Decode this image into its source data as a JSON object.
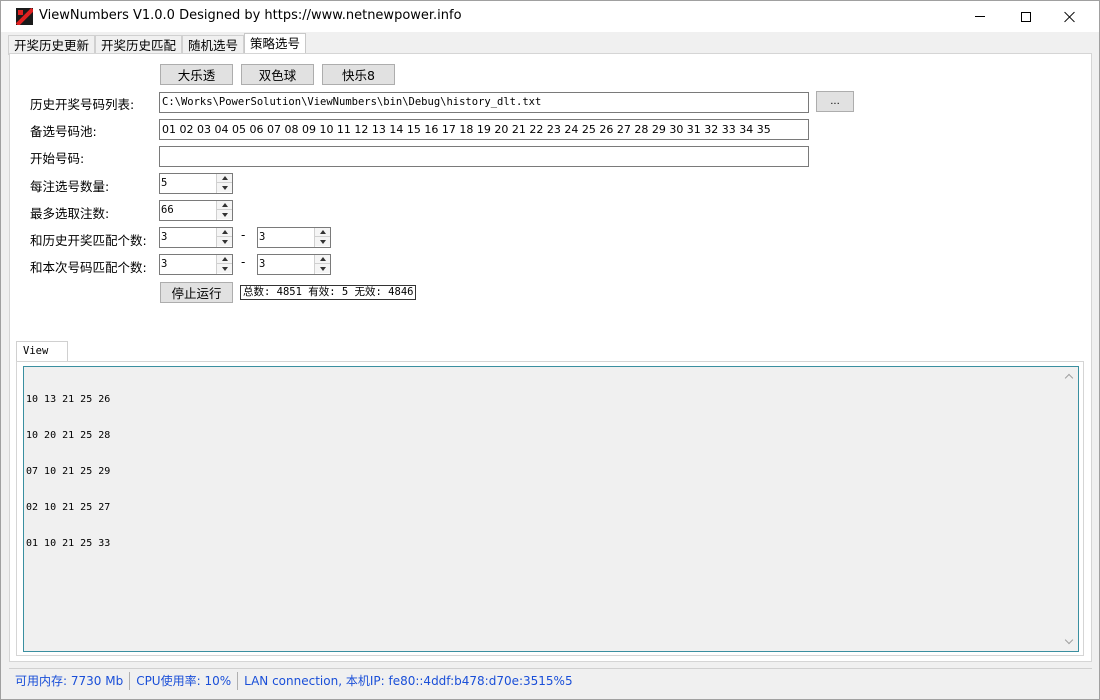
{
  "window": {
    "title": "ViewNumbers V1.0.0 Designed by https://www.netnewpower.info"
  },
  "main_tabs": [
    {
      "label": "开奖历史更新",
      "active": false
    },
    {
      "label": "开奖历史匹配",
      "active": false
    },
    {
      "label": "随机选号",
      "active": false
    },
    {
      "label": "策略选号",
      "active": true
    }
  ],
  "lottery_buttons": {
    "daletou": "大乐透",
    "shuangseqiu": "双色球",
    "kuaile8": "快乐8"
  },
  "form": {
    "history_file": {
      "label": "历史开奖号码列表:",
      "value": "C:\\Works\\PowerSolution\\ViewNumbers\\bin\\Debug\\history_dlt.txt",
      "browse_label": "..."
    },
    "candidate_pool": {
      "label": "备选号码池:",
      "value": "01 02 03 04 05 06 07 08 09 10 11 12 13 14 15 16 17 18 19 20 21 22 23 24 25 26 27 28 29 30 31 32 33 34 35"
    },
    "start_numbers": {
      "label": "开始号码:",
      "value": ""
    },
    "per_ticket_count": {
      "label": "每注选号数量:",
      "value": "5"
    },
    "max_tickets": {
      "label": "最多选取注数:",
      "value": "66"
    },
    "history_match": {
      "label": "和历史开奖匹配个数:",
      "min": "3",
      "max": "3",
      "separator": "-"
    },
    "current_match": {
      "label": "和本次号码匹配个数:",
      "min": "3",
      "max": "3",
      "separator": "-"
    },
    "stop_button": "停止运行",
    "stats": "总数: 4851 有效: 5 无效: 4846"
  },
  "view": {
    "tab_label": "View",
    "lines": [
      "10 13 21 25 26",
      "10 20 21 25 28",
      "07 10 21 25 29",
      "02 10 21 25 27",
      "01 10 21 25 33"
    ]
  },
  "statusbar": {
    "memory": "可用内存: 7730 Mb",
    "cpu": "CPU使用率: 10%",
    "network": "LAN connection, 本机IP: fe80::4ddf:b478:d70e:3515%5"
  },
  "colors": {
    "status_text": "#1a4fd8",
    "view_border": "#3a8fa0"
  }
}
